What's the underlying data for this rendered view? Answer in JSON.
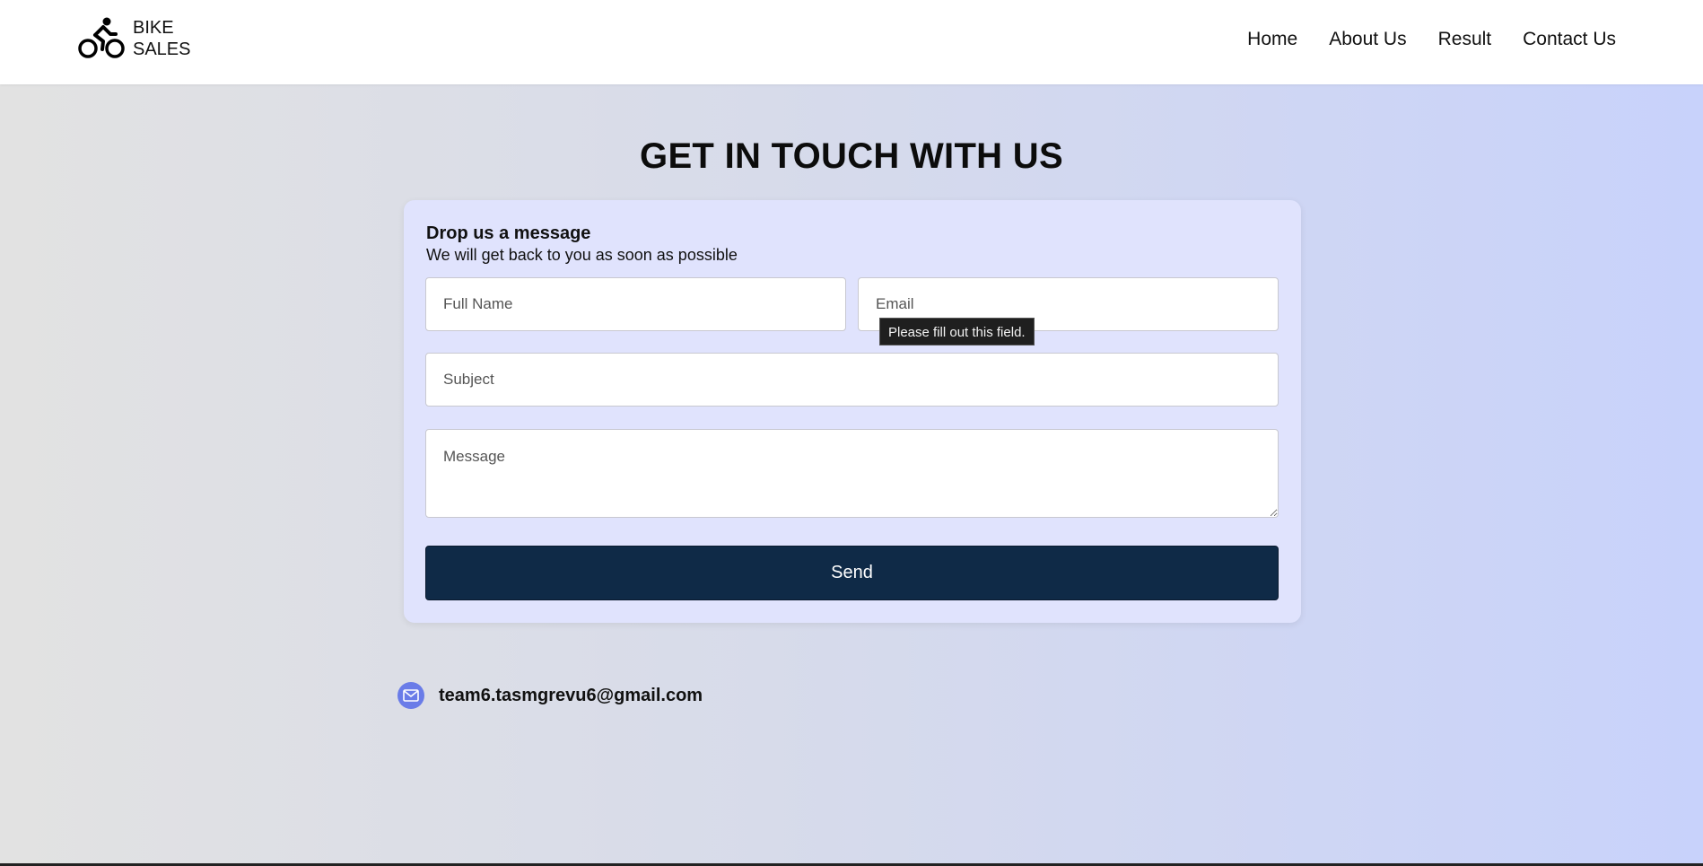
{
  "brand": {
    "line1": "BIKE",
    "line2": "SALES",
    "logo_icon": "cyclist-icon"
  },
  "nav": {
    "items": [
      {
        "label": "Home"
      },
      {
        "label": "About Us"
      },
      {
        "label": "Result"
      },
      {
        "label": "Contact Us"
      }
    ]
  },
  "page": {
    "title": "GET IN TOUCH WITH US"
  },
  "form": {
    "heading": "Drop us a message",
    "subheading": "We will get back to you as soon as possible",
    "full_name_placeholder": "Full Name",
    "email_placeholder": "Email",
    "subject_placeholder": "Subject",
    "message_placeholder": "Message",
    "validation_tooltip": "Please fill out this field.",
    "send_label": "Send"
  },
  "contact": {
    "email": "team6.tasmgrevu6@gmail.com",
    "icon": "mail-icon"
  },
  "colors": {
    "button": "#0f2a47",
    "card": "#e0e3fd",
    "mail_icon_bg": "#6a7ce8"
  }
}
